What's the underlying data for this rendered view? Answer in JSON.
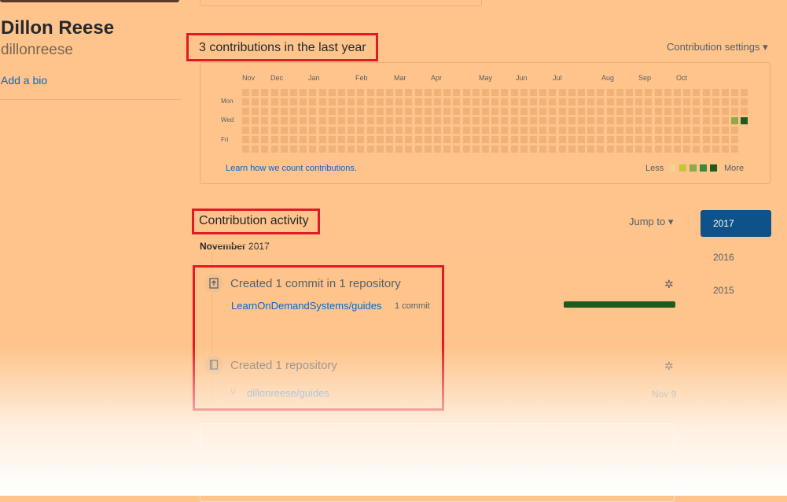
{
  "profile": {
    "full_name": "Dillon Reese",
    "username": "dillonreese",
    "add_bio": "Add a bio"
  },
  "contributions": {
    "title": "3 contributions in the last year",
    "settings": "Contribution settings ▾",
    "months": [
      "Nov",
      "Dec",
      "Jan",
      "Feb",
      "Mar",
      "Apr",
      "May",
      "Jun",
      "Jul",
      "Aug",
      "Sep",
      "Oct"
    ],
    "days": [
      "Mon",
      "Wed",
      "Fri"
    ],
    "learn_link": "Learn how we count contributions.",
    "legend_less": "Less",
    "legend_more": "More",
    "legend_colors": [
      "#f4d194",
      "#c6c43a",
      "#8fa84a",
      "#3b8a3b",
      "#1e5b1e"
    ],
    "active_cells": [
      {
        "week": 51,
        "day": 3,
        "color": "#8fa84a"
      },
      {
        "week": 52,
        "day": 3,
        "color": "#1e5b1e"
      }
    ]
  },
  "activity": {
    "title": "Contribution activity",
    "jump_to": "Jump to ▾",
    "years": [
      "2017",
      "2016",
      "2015"
    ],
    "month_label": "November",
    "month_year": "2017",
    "events": [
      {
        "title": "Created 1 commit in 1 repository",
        "repo": "LearnOnDemandSystems/guides",
        "count": "1 commit"
      },
      {
        "title": "Created 1 repository",
        "repo": "dillonreese/guides",
        "date": "Nov 9"
      }
    ]
  },
  "colors": {
    "accent_blue": "#0366d6",
    "highlight_red": "#e01b24",
    "year_selected": "#0f5289"
  }
}
